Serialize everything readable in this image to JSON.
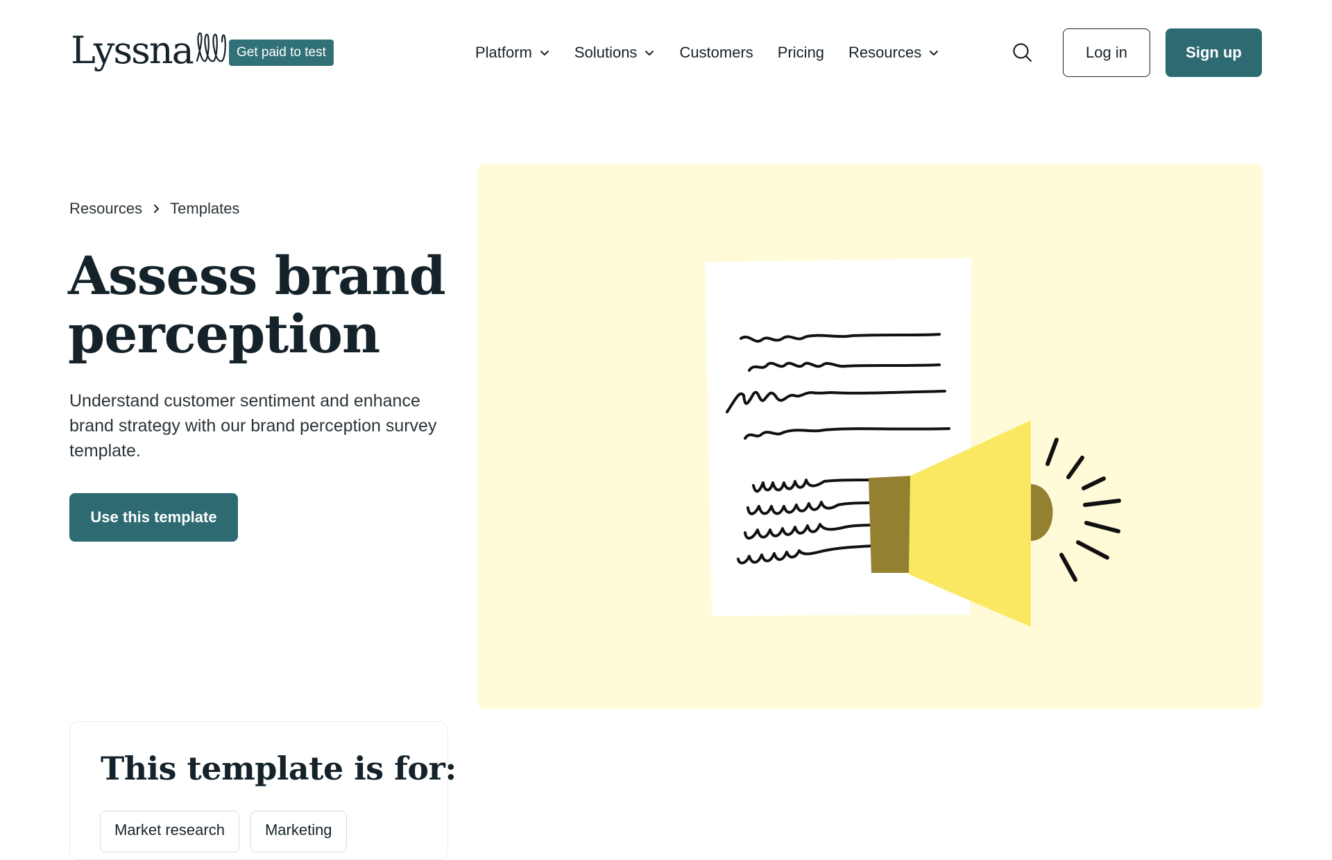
{
  "header": {
    "logo_text": "Lyssna",
    "badge_label": "Get paid to test",
    "nav": [
      {
        "label": "Platform",
        "has_dropdown": true
      },
      {
        "label": "Solutions",
        "has_dropdown": true
      },
      {
        "label": "Customers",
        "has_dropdown": false
      },
      {
        "label": "Pricing",
        "has_dropdown": false
      },
      {
        "label": "Resources",
        "has_dropdown": true
      }
    ],
    "search_icon": "search-icon",
    "login_label": "Log in",
    "signup_label": "Sign up"
  },
  "breadcrumb": {
    "items": [
      "Resources",
      "Templates"
    ],
    "separator_icon": "chevron-right-icon"
  },
  "main": {
    "title": "Assess brand perception",
    "description": "Understand customer sentiment and enhance brand strategy with our brand perception survey template.",
    "cta_label": "Use this template"
  },
  "illustration": {
    "subject": "megaphone-document-illustration",
    "colors": {
      "panel_bg": "#fffbd8",
      "paper": "#ffffff",
      "megaphone_yellow": "#fbe862",
      "megaphone_olive": "#948031",
      "ink": "#111111"
    }
  },
  "template_for": {
    "title": "This template is for:",
    "tags": [
      "Market research",
      "Marketing"
    ]
  },
  "colors": {
    "brand_teal": "#2d6a72",
    "badge_teal": "#317178",
    "text_dark": "#15222a"
  }
}
